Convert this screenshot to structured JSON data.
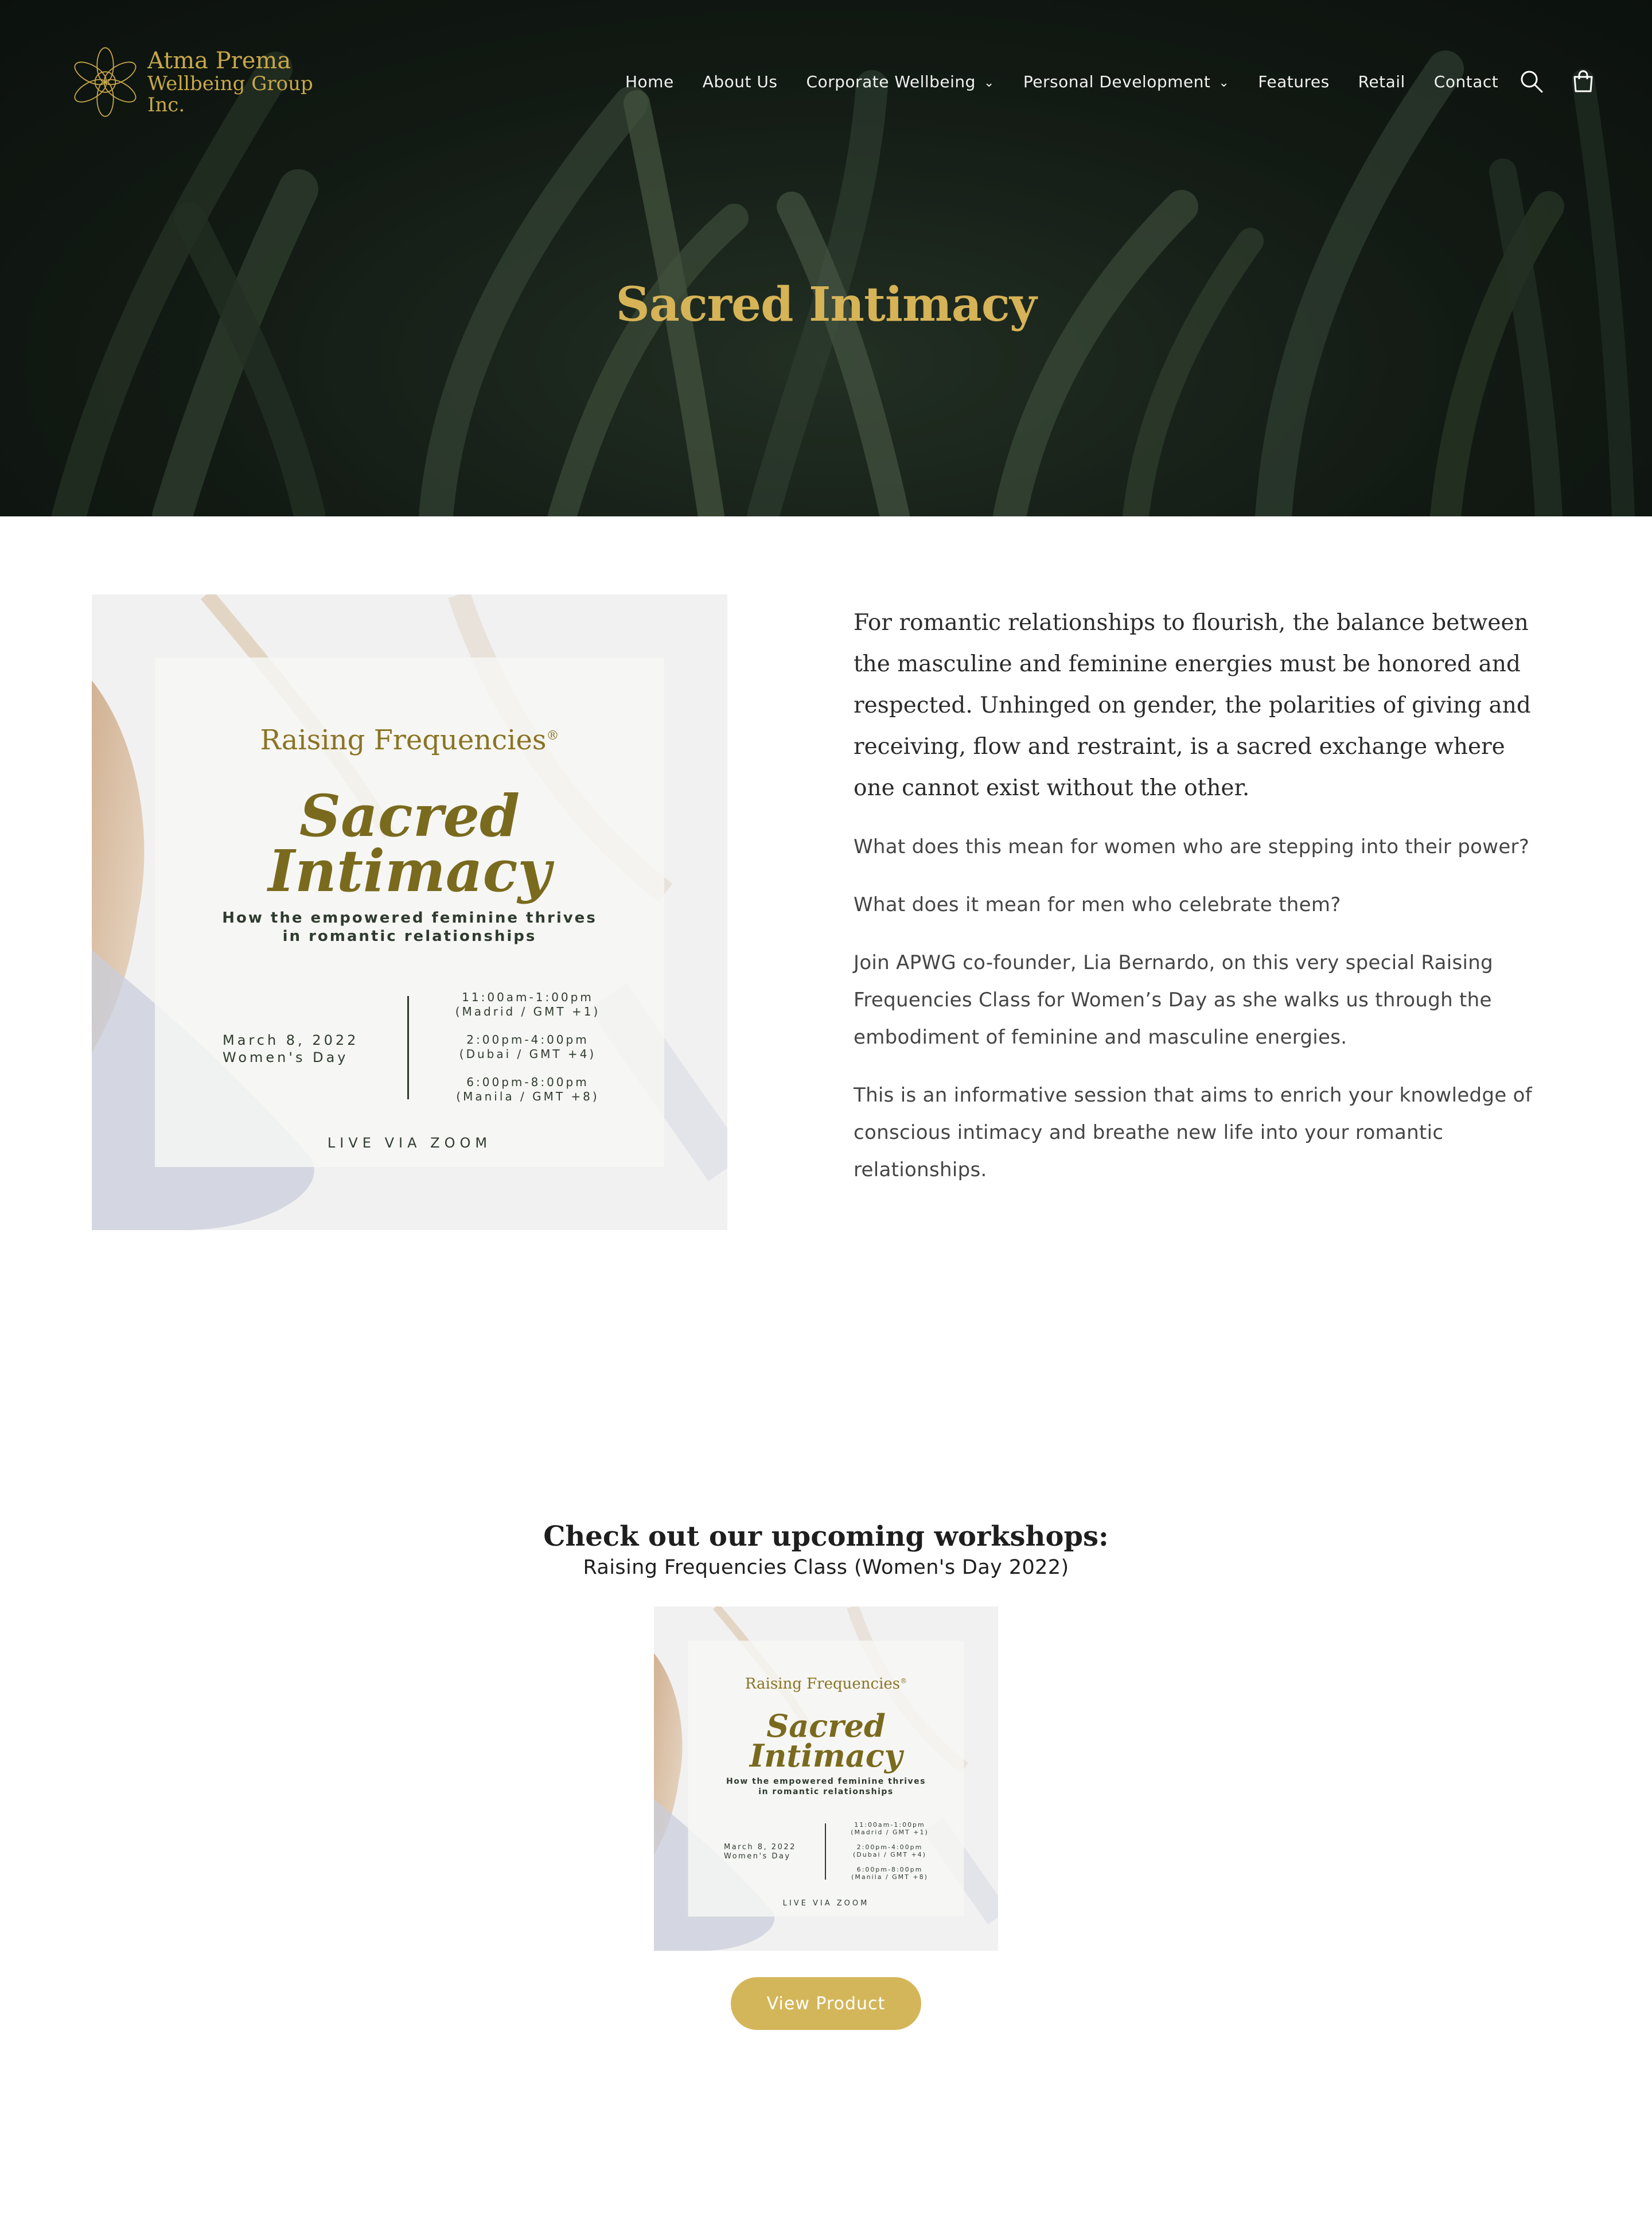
{
  "header": {
    "logo": {
      "line1": "Atma Prema",
      "line2": "Wellbeing Group Inc."
    },
    "nav": [
      {
        "label": "Home",
        "has_dropdown": false
      },
      {
        "label": "About Us",
        "has_dropdown": false
      },
      {
        "label": "Corporate Wellbeing",
        "has_dropdown": true
      },
      {
        "label": "Personal Development",
        "has_dropdown": true
      },
      {
        "label": "Features",
        "has_dropdown": false
      },
      {
        "label": "Retail",
        "has_dropdown": false
      },
      {
        "label": "Contact",
        "has_dropdown": false
      }
    ],
    "icons": [
      "search-icon",
      "cart-icon",
      "chevron-down-icon"
    ]
  },
  "hero": {
    "title": "Sacred Intimacy"
  },
  "poster": {
    "brand": "Raising Frequencies",
    "trademark": "®",
    "title_line1": "Sacred",
    "title_line2": "Intimacy",
    "subtitle_line1": "How the empowered feminine thrives",
    "subtitle_line2": "in romantic relationships",
    "date": "March 8, 2022",
    "occasion": "Women's Day",
    "times": [
      {
        "time": "11:00am-1:00pm",
        "zone": "(Madrid / GMT +1)"
      },
      {
        "time": "2:00pm-4:00pm",
        "zone": "(Dubai / GMT +4)"
      },
      {
        "time": "6:00pm-8:00pm",
        "zone": "(Manila / GMT +8)"
      }
    ],
    "footer": "LIVE VIA ZOOM"
  },
  "content": {
    "lead": "For romantic relationships to flourish, the balance between the masculine and feminine energies must be honored and respected. Unhinged on gender, the polarities of giving and receiving, flow and restraint, is a sacred exchange where one cannot exist without the other.",
    "paragraphs": [
      "What does this mean for women who are stepping into their power?",
      "What does it mean for men who celebrate them?",
      "Join APWG co-founder, Lia Bernardo, on this very special Raising Frequencies Class for Women’s Day as she walks us through the embodiment of feminine and masculine energies.",
      "This is an informative session that aims to enrich your knowledge of conscious intimacy and breathe new life into your romantic relationships."
    ]
  },
  "workshops": {
    "title": "Check out our upcoming workshops:",
    "product_title": "Raising Frequencies Class (Women's Day 2022)",
    "button_label": "View Product"
  },
  "colors": {
    "gold": "#d4b65a",
    "poster_gold": "#8a7424",
    "hero_title": "#d6b356",
    "hero_bg": "#151e17"
  }
}
